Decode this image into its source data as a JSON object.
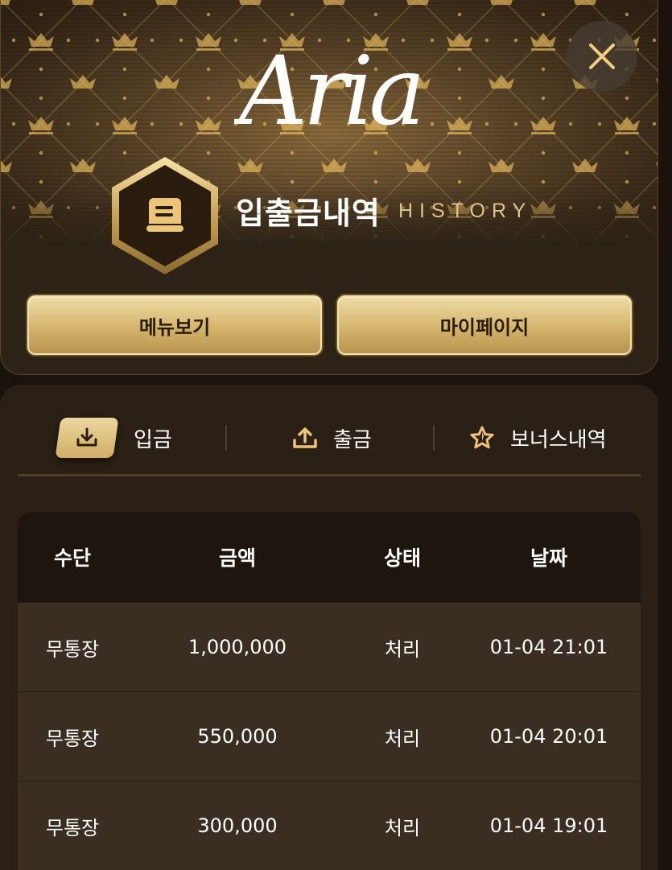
{
  "logo": {
    "text": "Aria"
  },
  "header": {
    "title": "입출금내역",
    "subtitle": "HISTORY",
    "close_icon": "close-icon",
    "badge_icon": "document-icon"
  },
  "buttons": {
    "menu_label": "메뉴보기",
    "mypage_label": "마이페이지"
  },
  "tabs": [
    {
      "label": "입금",
      "icon": "download-icon",
      "active": true
    },
    {
      "label": "출금",
      "icon": "upload-icon",
      "active": false
    },
    {
      "label": "보너스내역",
      "icon": "star-icon",
      "active": false
    }
  ],
  "table": {
    "headers": [
      "수단",
      "금액",
      "상태",
      "날짜"
    ],
    "rows": [
      [
        "무통장",
        "1,000,000",
        "처리",
        "01-04 21:01"
      ],
      [
        "무통장",
        "550,000",
        "처리",
        "01-04 20:01"
      ],
      [
        "무통장",
        "300,000",
        "처리",
        "01-04 19:01"
      ]
    ]
  },
  "colors": {
    "gold": "#d6b871",
    "gold_light": "#efdca6",
    "background": "#1a130d",
    "panel": "#2a2016"
  }
}
